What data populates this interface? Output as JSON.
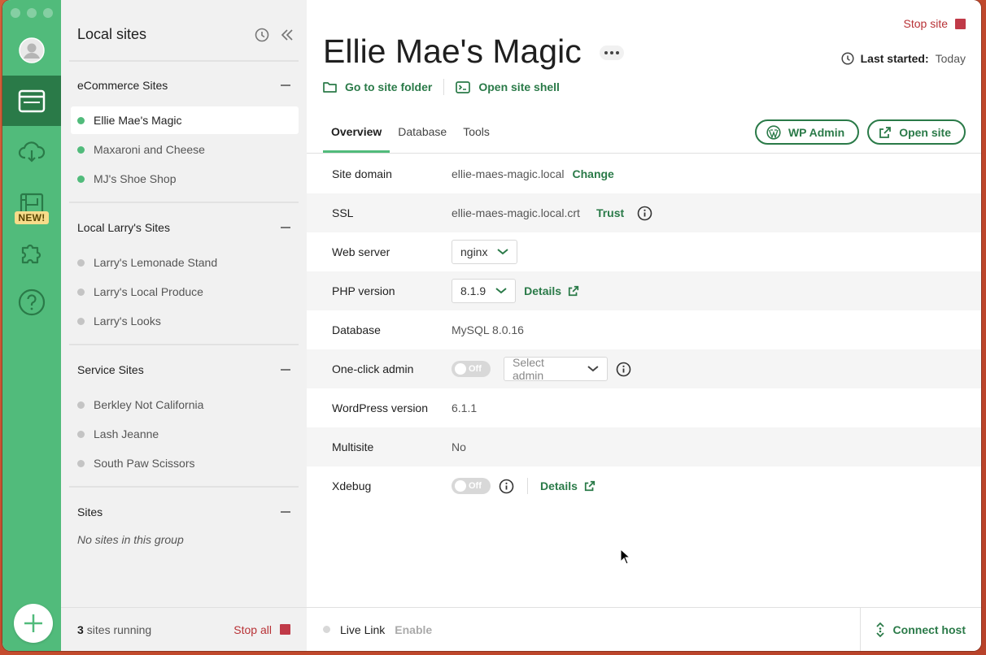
{
  "colors": {
    "accent_green": "#51bb7b",
    "dark_green": "#2a7a48",
    "stop_red": "#c03a48"
  },
  "sidebar": {
    "title": "Local sites",
    "groups": [
      {
        "name": "eCommerce Sites",
        "sites": [
          {
            "name": "Ellie Mae's Magic",
            "running": true,
            "active": true
          },
          {
            "name": "Maxaroni and Cheese",
            "running": true
          },
          {
            "name": "MJ's Shoe Shop",
            "running": true
          }
        ]
      },
      {
        "name": "Local Larry's Sites",
        "sites": [
          {
            "name": "Larry's Lemonade Stand",
            "running": false
          },
          {
            "name": "Larry's Local Produce",
            "running": false
          },
          {
            "name": "Larry's Looks",
            "running": false
          }
        ]
      },
      {
        "name": "Service Sites",
        "sites": [
          {
            "name": "Berkley Not California",
            "running": false
          },
          {
            "name": "Lash Jeanne",
            "running": false
          },
          {
            "name": "South Paw Scissors",
            "running": false
          }
        ]
      },
      {
        "name": "Sites",
        "empty_text": "No sites in this group"
      }
    ],
    "footer": {
      "count": "3",
      "running_text": "sites running",
      "stop_all": "Stop all"
    }
  },
  "rail": {
    "new_badge": "NEW!"
  },
  "site": {
    "title": "Ellie Mae's Magic",
    "stop_site": "Stop site",
    "last_started_label": "Last started:",
    "last_started_value": "Today",
    "go_to_folder": "Go to site folder",
    "open_shell": "Open site shell",
    "tabs": [
      "Overview",
      "Database",
      "Tools"
    ],
    "wp_admin": "WP Admin",
    "open_site": "Open site"
  },
  "overview": {
    "site_domain": {
      "label": "Site domain",
      "value": "ellie-maes-magic.local",
      "action": "Change"
    },
    "ssl": {
      "label": "SSL",
      "value": "ellie-maes-magic.local.crt",
      "action": "Trust"
    },
    "web_server": {
      "label": "Web server",
      "value": "nginx"
    },
    "php_version": {
      "label": "PHP version",
      "value": "8.1.9",
      "action": "Details"
    },
    "database": {
      "label": "Database",
      "value": "MySQL 8.0.16"
    },
    "one_click_admin": {
      "label": "One-click admin",
      "toggle": "Off",
      "select_placeholder": "Select admin"
    },
    "wp_version": {
      "label": "WordPress version",
      "value": "6.1.1"
    },
    "multisite": {
      "label": "Multisite",
      "value": "No"
    },
    "xdebug": {
      "label": "Xdebug",
      "toggle": "Off",
      "action": "Details"
    }
  },
  "footer": {
    "live_link": "Live Link",
    "enable": "Enable",
    "connect_host": "Connect host"
  }
}
